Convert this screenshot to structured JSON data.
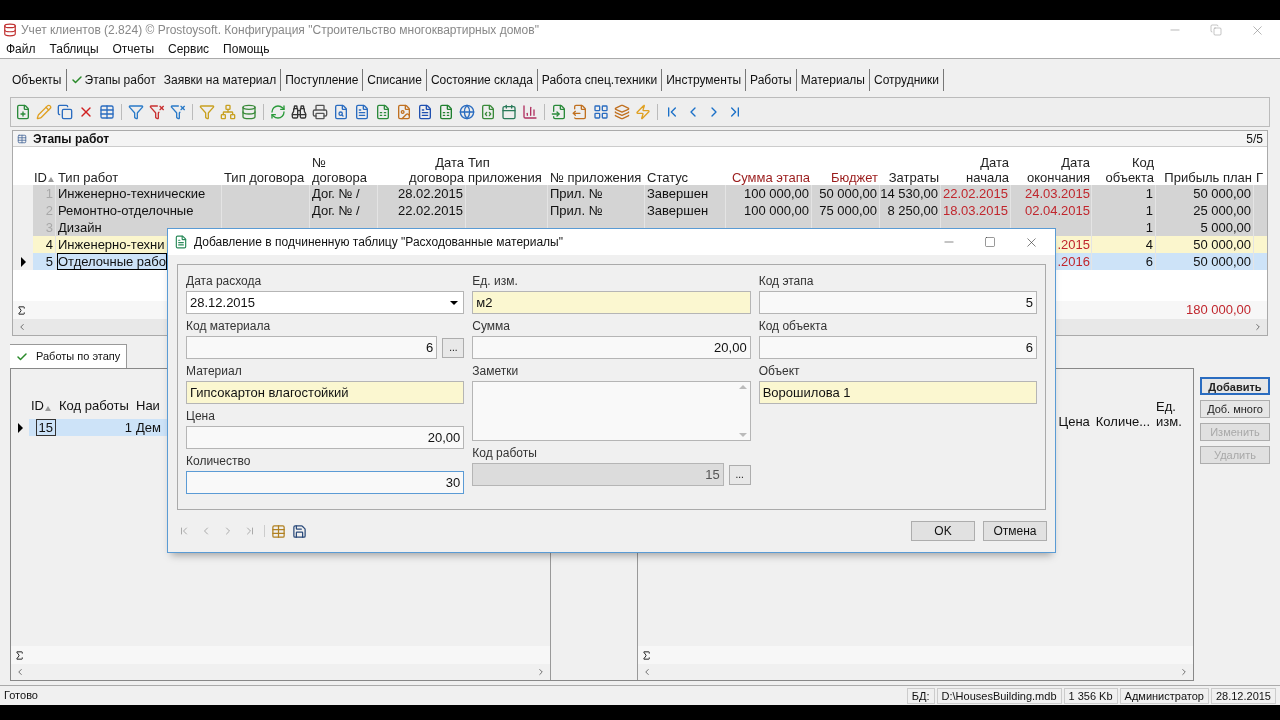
{
  "window": {
    "title": "Учет клиентов (2.824) © Prostoysoft. Конфигурация \"Строительство многоквартирных домов\""
  },
  "menu": [
    "Файл",
    "Таблицы",
    "Отчеты",
    "Сервис",
    "Помощь"
  ],
  "tabs": [
    {
      "label": "Объекты",
      "selected": false
    },
    {
      "label": "Этапы работ",
      "selected": true
    },
    {
      "label": "Заявки на материал",
      "selected": false
    },
    {
      "label": "Поступление",
      "selected": false
    },
    {
      "label": "Списание",
      "selected": false
    },
    {
      "label": "Состояние склада",
      "selected": false
    },
    {
      "label": "Работа спец.техники",
      "selected": false
    },
    {
      "label": "Инструменты",
      "selected": false
    },
    {
      "label": "Работы",
      "selected": false
    },
    {
      "label": "Материалы",
      "selected": false
    },
    {
      "label": "Сотрудники",
      "selected": false
    }
  ],
  "grid": {
    "title": "Этапы работ",
    "counter": "5/5",
    "columns": [
      {
        "label": "ID",
        "sorted": true
      },
      {
        "label": "Тип работ",
        "sorted": false
      },
      {
        "label": "Тип договора",
        "sorted": false
      },
      {
        "label": "№ договора",
        "sorted": false
      },
      {
        "label": "Дата договора",
        "sorted": false
      },
      {
        "label": "Тип приложения",
        "sorted": false
      },
      {
        "label": "№ приложения",
        "sorted": false
      },
      {
        "label": "Статус",
        "sorted": false
      },
      {
        "label": "Сумма этапа",
        "sorted": false,
        "color": "#9b1c1c"
      },
      {
        "label": "Бюджет",
        "sorted": false,
        "color": "#9b1c1c"
      },
      {
        "label": "Затраты",
        "sorted": false
      },
      {
        "label": "Дата начала",
        "sorted": false
      },
      {
        "label": "Дата окончания",
        "sorted": false
      },
      {
        "label": "Код объекта",
        "sorted": false
      },
      {
        "label": "Прибыль план",
        "sorted": false
      },
      {
        "label": "Г",
        "sorted": false
      }
    ],
    "rows": [
      {
        "kind": "done",
        "selected": false,
        "cells": [
          "1",
          "Инженерно-технические",
          null,
          "Дог. № /",
          "28.02.2015",
          null,
          "Прил. №",
          "Завершен",
          "100 000,00",
          "50 000,00",
          "14 530,00",
          "22.02.2015",
          "24.03.2015",
          "1",
          "50 000,00",
          null
        ]
      },
      {
        "kind": "done",
        "selected": false,
        "cells": [
          "2",
          "Ремонтно-отделочные",
          null,
          "Дог. № /",
          "22.02.2015",
          null,
          "Прил. №",
          "Завершен",
          "100 000,00",
          "75 000,00",
          "8 250,00",
          "18.03.2015",
          "02.04.2015",
          "1",
          "25 000,00",
          null
        ]
      },
      {
        "kind": "done",
        "selected": false,
        "cells": [
          "3",
          "Дизайн",
          null,
          null,
          null,
          null,
          null,
          null,
          null,
          null,
          null,
          null,
          null,
          "1",
          "5 000,00",
          null
        ]
      },
      {
        "kind": "marked",
        "selected": false,
        "cells": [
          "4",
          "Инженерно-техни",
          null,
          null,
          null,
          null,
          null,
          null,
          null,
          null,
          null,
          null,
          ".2015",
          "4",
          "50 000,00",
          null
        ]
      },
      {
        "kind": "normal",
        "selected": true,
        "cells": [
          "5",
          "Отделочные рабо",
          null,
          null,
          null,
          null,
          null,
          null,
          null,
          null,
          null,
          null,
          ".2016",
          "6",
          "50 000,00",
          null
        ]
      }
    ],
    "totals": {
      "profit": "180 000,00"
    }
  },
  "detail_tabs": [
    {
      "label": "Работы по этапу",
      "selected": true
    }
  ],
  "works_grid": {
    "columns": [
      {
        "label": "ID",
        "sorted": true
      },
      {
        "label": "Код работы",
        "sorted": false
      },
      {
        "label": "Наи",
        "sorted": false
      }
    ],
    "rows": [
      {
        "selected": true,
        "cells": [
          "15",
          "1",
          "Дем"
        ]
      }
    ]
  },
  "materials_grid": {
    "columns": [
      {
        "label": "Цена"
      },
      {
        "label": "Количе..."
      },
      {
        "label": "Ед. изм."
      }
    ]
  },
  "side_buttons": [
    {
      "label": "Добавить",
      "disabled": false,
      "default": true
    },
    {
      "label": "Доб. много",
      "disabled": false,
      "default": false
    },
    {
      "label": "Изменить",
      "disabled": true,
      "default": false
    },
    {
      "label": "Удалить",
      "disabled": true,
      "default": false
    }
  ],
  "dialog": {
    "title": "Добавление в подчиненную таблицу \"Расходованные материалы\"",
    "columns": [
      [
        {
          "label": "Дата расхода",
          "kind": "combo",
          "value": "28.12.2015",
          "focused": false,
          "disabled": false
        },
        {
          "label": "Код материала",
          "kind": "picker",
          "value": "6",
          "button": "...",
          "focused": false,
          "disabled": false
        },
        {
          "label": "Материал",
          "kind": "lookup",
          "value": "Гипсокартон влагостойкий",
          "focused": false,
          "disabled": false
        },
        {
          "label": "Цена",
          "kind": "number",
          "value": "20,00",
          "focused": false,
          "disabled": false
        },
        {
          "label": "Количество",
          "kind": "number",
          "value": "30",
          "focused": true,
          "disabled": false
        }
      ],
      [
        {
          "label": "Ед. изм.",
          "kind": "lookup",
          "value": "м2",
          "focused": false,
          "disabled": false
        },
        {
          "label": "Сумма",
          "kind": "number",
          "value": "20,00",
          "focused": false,
          "disabled": false
        },
        {
          "label": "Заметки",
          "kind": "memo",
          "focused": false,
          "disabled": false
        },
        {
          "label": "Код работы",
          "kind": "picker",
          "value": "15",
          "button": "...",
          "focused": false,
          "disabled": true
        }
      ],
      [
        {
          "label": "Код этапа",
          "kind": "number",
          "value": "5",
          "focused": false,
          "disabled": false
        },
        {
          "label": "Код объекта",
          "kind": "number",
          "value": "6",
          "focused": false,
          "disabled": false
        },
        {
          "label": "Объект",
          "kind": "lookup",
          "value": "Ворошилова 1",
          "focused": false,
          "disabled": false
        }
      ]
    ],
    "buttons": [
      "OK",
      "Отмена"
    ]
  },
  "status_bar": {
    "message": "Готово",
    "panels": [
      "БД:",
      "D:\\HousesBuilding.mdb",
      "1 356 Kb",
      "Администратор",
      "28.12.2015"
    ]
  }
}
